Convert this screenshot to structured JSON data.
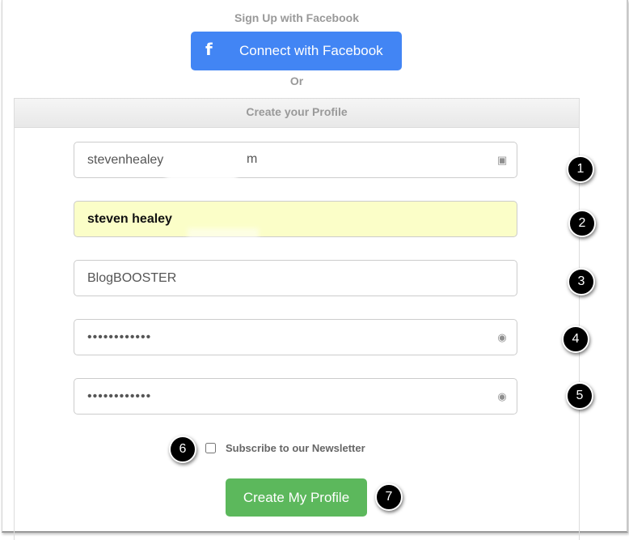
{
  "facebook": {
    "heading": "Sign Up with Facebook",
    "button_label": "Connect with Facebook",
    "icon": "facebook-f-icon",
    "icon_glyph": "f",
    "color": "#4285f4"
  },
  "separator": "Or",
  "panel": {
    "title": "Create your Profile"
  },
  "fields": {
    "email": {
      "value": "stevenhealey",
      "value_suffix": "m",
      "icon": "contact-card-icon",
      "icon_glyph": "▣"
    },
    "name": {
      "value": "steven healey"
    },
    "blog": {
      "value": "BlogBOOSTER"
    },
    "password": {
      "value": "••••••••••••",
      "icon": "password-key-icon",
      "icon_glyph": "◉"
    },
    "password_confirm": {
      "value": "••••••••••••",
      "icon": "password-key-icon",
      "icon_glyph": "◉"
    }
  },
  "newsletter": {
    "label": "Subscribe to our Newsletter",
    "checked": false
  },
  "create_button": {
    "label": "Create My Profile",
    "color": "#5cb85c"
  },
  "step_markers": [
    "1",
    "2",
    "3",
    "4",
    "5",
    "6",
    "7"
  ]
}
